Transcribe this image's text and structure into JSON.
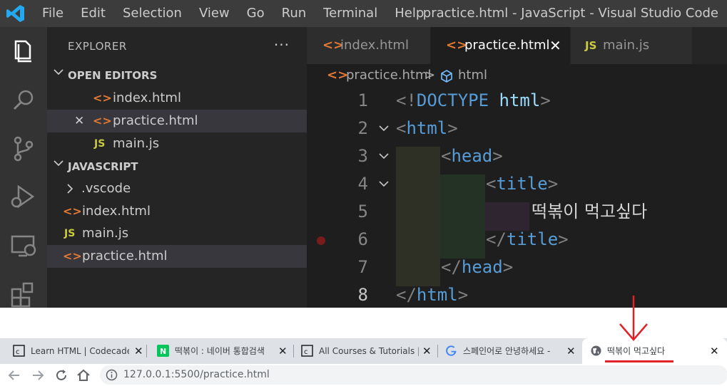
{
  "vscode": {
    "menu": [
      "File",
      "Edit",
      "Selection",
      "View",
      "Go",
      "Run",
      "Terminal",
      "Help"
    ],
    "window_title": "practice.html - JavaScript - Visual Studio Code",
    "activity_icons": [
      "explorer-icon",
      "search-icon",
      "source-control-icon",
      "run-debug-icon",
      "remote-explorer-icon",
      "extensions-icon"
    ],
    "sidebar": {
      "title": "EXPLORER",
      "more": "···",
      "open_editors": {
        "label": "OPEN EDITORS",
        "items": [
          {
            "icon": "<>",
            "name": "index.html"
          },
          {
            "icon": "<>",
            "name": "practice.html",
            "close": "✕"
          },
          {
            "icon": "JS",
            "name": "main.js"
          }
        ]
      },
      "folder": {
        "label": "JAVASCRIPT",
        "items": [
          {
            "icon": "",
            "name": ".vscode"
          },
          {
            "icon": "<>",
            "name": "index.html"
          },
          {
            "icon": "JS",
            "name": "main.js"
          },
          {
            "icon": "<>",
            "name": "practice.html"
          }
        ]
      }
    },
    "tabs": [
      {
        "icon": "<>",
        "name": "index.html"
      },
      {
        "icon": "<>",
        "name": "practice.html",
        "close": "✕"
      },
      {
        "icon": "JS",
        "name": "main.js"
      }
    ],
    "breadcrumb": {
      "file_icon": "<>",
      "file": "practice.html",
      "separator": ">",
      "element": "html"
    },
    "code_lines": [
      {
        "num": "1",
        "open": "<!",
        "name": "DOCTYPE",
        "rest": " html",
        "close": ">"
      },
      {
        "num": "2",
        "open": "<",
        "name": "html",
        "close": ">"
      },
      {
        "num": "3",
        "open": "<",
        "name": "head",
        "close": ">"
      },
      {
        "num": "4",
        "open": "<",
        "name": "title",
        "close": ">"
      },
      {
        "num": "5",
        "text": "떡볶이 먹고싶다"
      },
      {
        "num": "6",
        "open": "</",
        "name": "title",
        "close": ">"
      },
      {
        "num": "7",
        "open": "</",
        "name": "head",
        "close": ">"
      },
      {
        "num": "8",
        "open": "</",
        "name": "html",
        "close": ">"
      }
    ],
    "colors": {
      "accent": "#007acc",
      "html_icon": "#e37933",
      "js_icon": "#cbcb41",
      "tag": "#569cd6"
    }
  },
  "browser": {
    "tabs": [
      {
        "favicon": "codecademy-icon",
        "title": "Learn HTML | Codecadem",
        "close": "✕"
      },
      {
        "favicon": "naver-icon",
        "title": "떡볶이 : 네이버 통합검색",
        "close": "✕"
      },
      {
        "favicon": "codecademy-icon",
        "title": "All Courses & Tutorials | C",
        "close": "✕"
      },
      {
        "favicon": "google-icon",
        "title": "스페인어로 안녕하세요 -",
        "close": "✕"
      },
      {
        "favicon": "globe-icon",
        "title": "떡볶이 먹고싶다",
        "close": "✕"
      }
    ],
    "url": "127.0.0.1:5500/practice.html"
  },
  "annotation_color": "#e2202a"
}
